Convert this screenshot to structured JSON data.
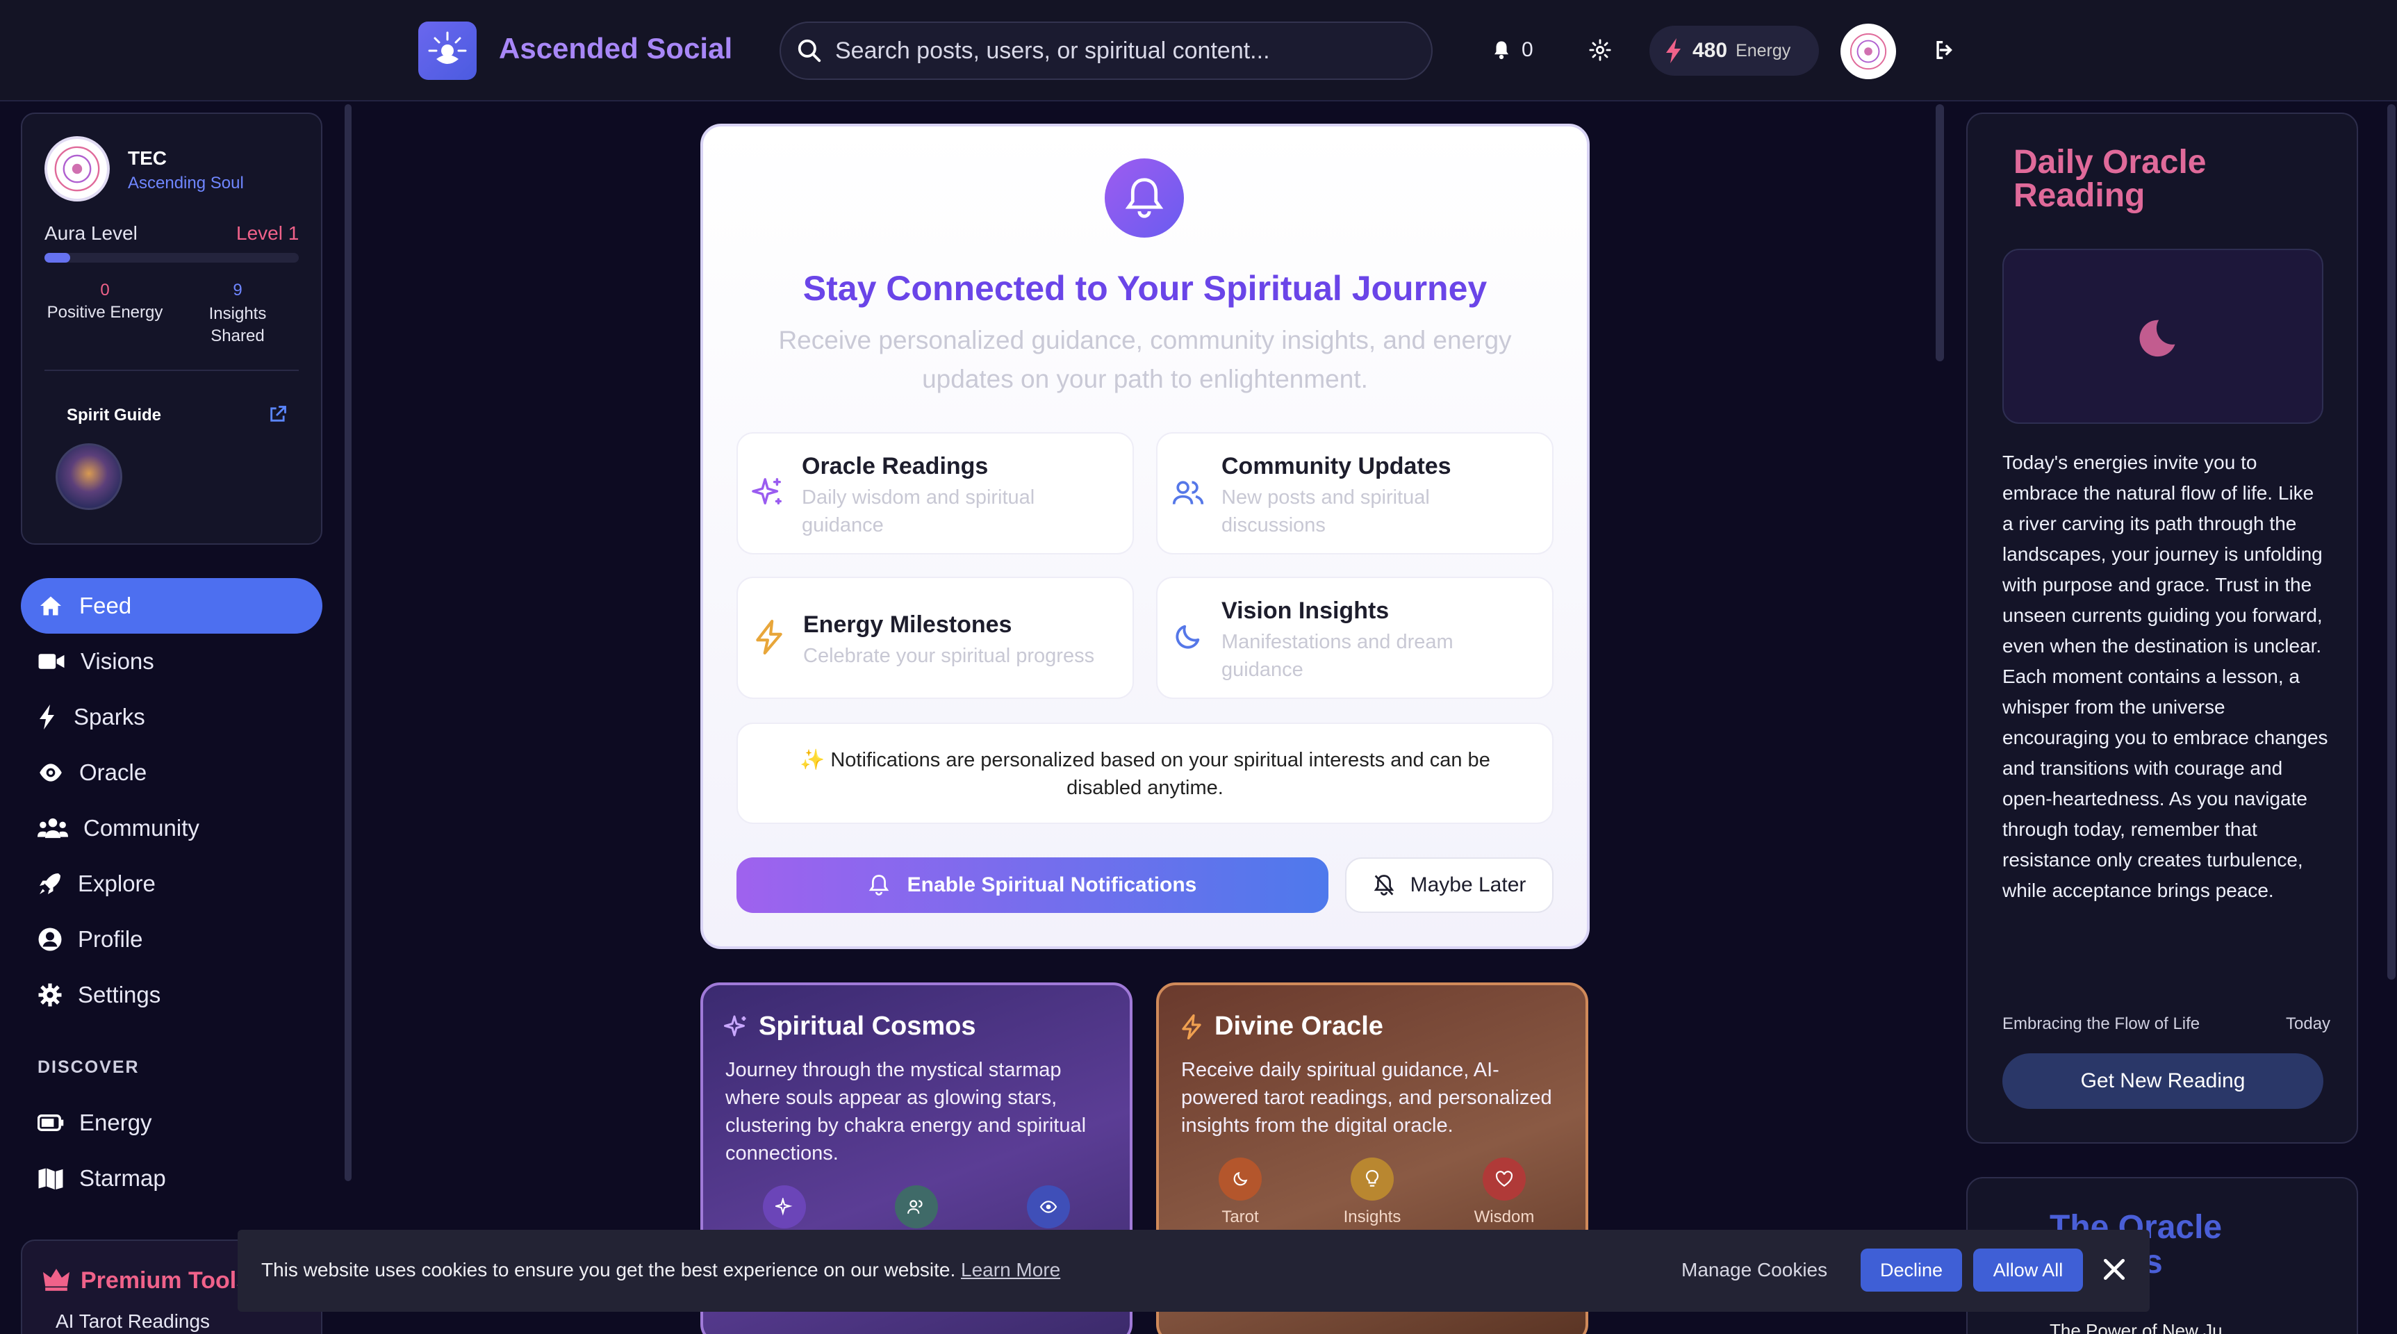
{
  "header": {
    "app_title": "Ascended Social",
    "search_placeholder": "Search posts, users, or spiritual content...",
    "notification_count": "0",
    "energy_value": "480",
    "energy_label": "Energy"
  },
  "profile": {
    "name": "TEC",
    "rank": "Ascending Soul",
    "aura_label": "Aura Level",
    "aura_level": "Level 1",
    "aura_progress_fraction": 0.05,
    "positive_energy_value": "0",
    "positive_energy_label": "Positive Energy",
    "insights_value": "9",
    "insights_label": "Insights Shared",
    "spirit_guide_label": "Spirit Guide"
  },
  "nav": {
    "items": [
      {
        "label": "Feed",
        "icon": "home-icon",
        "active": true
      },
      {
        "label": "Visions",
        "icon": "video-icon"
      },
      {
        "label": "Sparks",
        "icon": "bolt-icon"
      },
      {
        "label": "Oracle",
        "icon": "eye-icon"
      },
      {
        "label": "Community",
        "icon": "users-icon"
      },
      {
        "label": "Explore",
        "icon": "rocket-icon"
      },
      {
        "label": "Profile",
        "icon": "user-circle-icon"
      },
      {
        "label": "Settings",
        "icon": "gear-icon"
      }
    ],
    "discover_label": "DISCOVER",
    "discover_items": [
      {
        "label": "Energy",
        "icon": "battery-icon"
      },
      {
        "label": "Starmap",
        "icon": "map-icon"
      }
    ],
    "premium_title": "Premium Tools",
    "premium_item": "AI Tarot Readings"
  },
  "notification_prompt": {
    "title": "Stay Connected to Your Spiritual Journey",
    "subtitle": "Receive personalized guidance, community insights, and energy updates on your path to enlightenment.",
    "features": [
      {
        "title": "Oracle Readings",
        "desc": "Daily wisdom and spiritual guidance",
        "icon": "sparkles-icon"
      },
      {
        "title": "Community Updates",
        "desc": "New posts and spiritual discussions",
        "icon": "users-icon"
      },
      {
        "title": "Energy Milestones",
        "desc": "Celebrate your spiritual progress",
        "icon": "bolt-icon"
      },
      {
        "title": "Vision Insights",
        "desc": "Manifestations and dream guidance",
        "icon": "moon-icon"
      }
    ],
    "info_text": "✨ Notifications are personalized based on your spiritual interests and can be disabled anytime.",
    "enable_button": "Enable Spiritual Notifications",
    "later_button": "Maybe Later"
  },
  "cards": {
    "cosmos": {
      "title": "Spiritual Cosmos",
      "desc": "Journey through the mystical starmap where souls appear as glowing stars, clustering by chakra energy and spiritual connections."
    },
    "oracle": {
      "title": "Divine Oracle",
      "desc": "Receive daily spiritual guidance, AI-powered tarot readings, and personalized insights from the digital oracle.",
      "tags": [
        "Tarot",
        "Insights",
        "Wisdom"
      ]
    }
  },
  "daily_oracle": {
    "title": "Daily Oracle Reading",
    "reading": "Today's energies invite you to embrace the natural flow of life. Like a river carving its path through the landscapes, your journey is unfolding with purpose and grace. Trust in the unseen currents guiding you forward, even when the destination is unclear. Each moment contains a lesson, a whisper from the universe encouraging you to embrace changes and transitions with courage and open-heartedness. As you navigate through today, remember that resistance only creates turbulence, while acceptance brings peace.",
    "theme": "Embracing the Flow of Life",
    "date": "Today",
    "button": "Get New Reading"
  },
  "quests": {
    "title": "The Oracle Quests",
    "item": "The Power of New Ju..."
  },
  "cookie": {
    "text": "This website uses cookies to ensure you get the best experience on our website.",
    "learn_more": "Learn More",
    "manage": "Manage Cookies",
    "decline": "Decline",
    "allow": "Allow All"
  },
  "colors": {
    "accent": "#4d6ff0",
    "brand_purple": "#a887f7",
    "pink": "#f0628a",
    "bg": "#0d0b22"
  }
}
